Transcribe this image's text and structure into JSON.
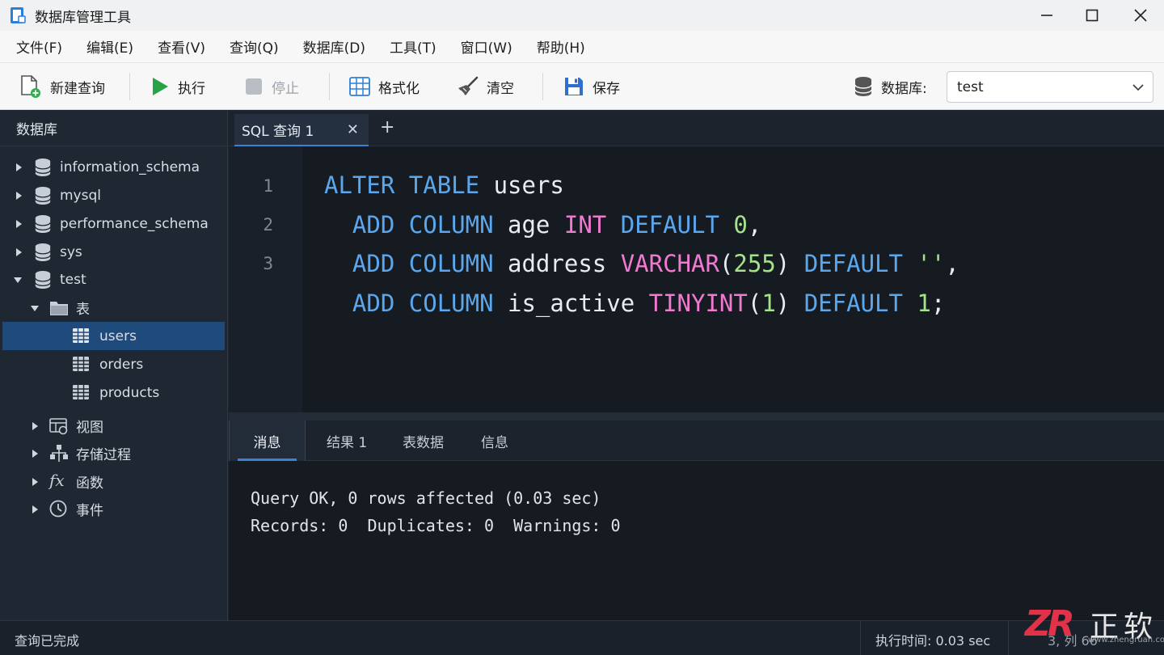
{
  "window": {
    "title": "数据库管理工具"
  },
  "menu": [
    "文件(F)",
    "编辑(E)",
    "查看(V)",
    "查询(Q)",
    "数据库(D)",
    "工具(T)",
    "窗口(W)",
    "帮助(H)"
  ],
  "toolbar": {
    "new_query": "新建查询",
    "execute": "执行",
    "stop": "停止",
    "format": "格式化",
    "clear": "清空",
    "save": "保存",
    "db_label": "数据库:",
    "db_value": "test"
  },
  "sidebar": {
    "header": "数据库",
    "databases": [
      "information_schema",
      "mysql",
      "performance_schema",
      "sys",
      "test"
    ],
    "tables_folder": "表",
    "tables": [
      "users",
      "orders",
      "products"
    ],
    "selected_table": "users",
    "groups": [
      "视图",
      "存储过程",
      "函数",
      "事件"
    ]
  },
  "editor": {
    "tab_label": "SQL 查询 1",
    "line_numbers": [
      "1",
      "2",
      "3"
    ],
    "code_lines": [
      "ALTER TABLE users",
      "  ADD COLUMN age INT DEFAULT 0,",
      "  ADD COLUMN address VARCHAR(255) DEFAULT '',",
      "  ADD COLUMN is_active TINYINT(1) DEFAULT 1;"
    ]
  },
  "results": {
    "tabs": [
      "消息",
      "结果 1",
      "表数据",
      "信息"
    ],
    "active_tab": "消息",
    "message_lines": [
      "Query OK, 0 rows affected (0.03 sec)",
      "Records: 0  Duplicates: 0  Warnings: 0"
    ]
  },
  "status": {
    "left": "查询已完成",
    "time": "执行时间: 0.03 sec",
    "position": "3, 列 66"
  },
  "watermark": {
    "logo": "ZR",
    "name": "正软",
    "url": "www.zhengruan.com"
  },
  "colors": {
    "keyword": "#5aa7ee",
    "type": "#f07ad0",
    "number": "#a5e28a",
    "accent": "#3b82d6",
    "selection": "#1f4a7c"
  }
}
